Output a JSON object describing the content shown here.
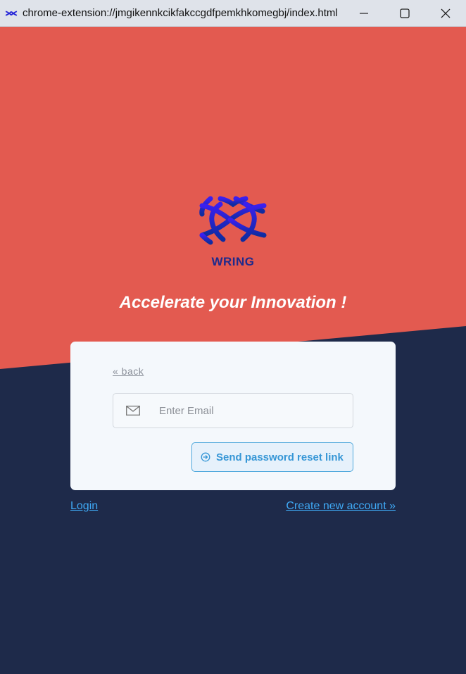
{
  "window": {
    "url": "chrome-extension://jmgikennkcikfakccgdfpemkhkomegbj/index.html"
  },
  "colors": {
    "accent_red": "#e35a50",
    "navy": "#1e2a4a",
    "brand_blue": "#1f2a8c",
    "link_blue": "#3fa9f5"
  },
  "brand": {
    "name": "WRING",
    "tagline": "Accelerate your Innovation !"
  },
  "card": {
    "back_label": "« back",
    "email_placeholder": "Enter Email",
    "send_label": "Send password reset link"
  },
  "links": {
    "login": "Login",
    "create_account": "Create new account »"
  }
}
